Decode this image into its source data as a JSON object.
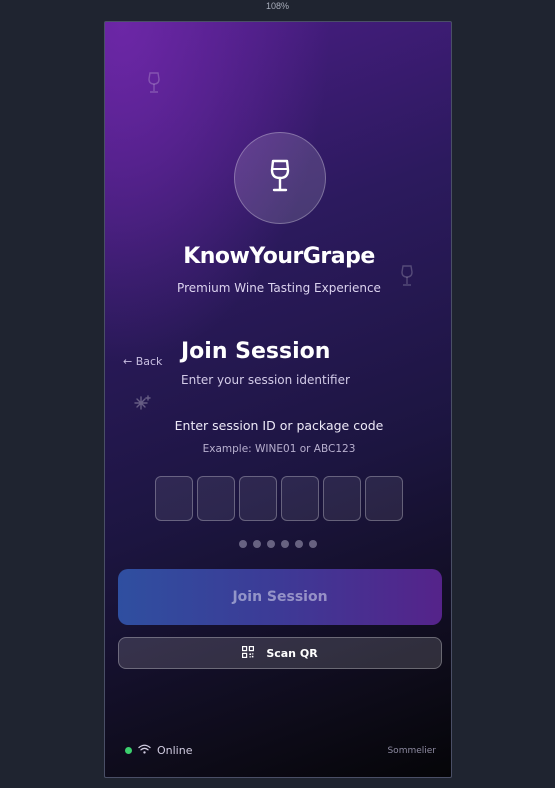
{
  "browser": {
    "zoom_label": "108%"
  },
  "brand": {
    "name": "KnowYourGrape",
    "tagline": "Premium Wine Tasting Experience",
    "logo_icon": "wine-glass-icon"
  },
  "navigation": {
    "back_label": "← Back"
  },
  "session": {
    "title": "Join Session",
    "subtitle": "Enter your session identifier",
    "prompt": "Enter session ID or package code",
    "example": "Example: WINE01 or ABC123",
    "code_length": 6,
    "code_values": [
      "",
      "",
      "",
      "",
      "",
      ""
    ]
  },
  "actions": {
    "join_label": "Join Session",
    "scan_label": "Scan QR",
    "scan_icon": "qr-code-icon"
  },
  "status": {
    "connection_label": "Online",
    "connection_color": "#3ccf6e",
    "role_label": "Sommelier"
  },
  "colors": {
    "gradient_start": "#4b1d86",
    "gradient_end": "#050508",
    "button_gradient_start": "#2f4fa0",
    "button_gradient_end": "#55238a"
  }
}
